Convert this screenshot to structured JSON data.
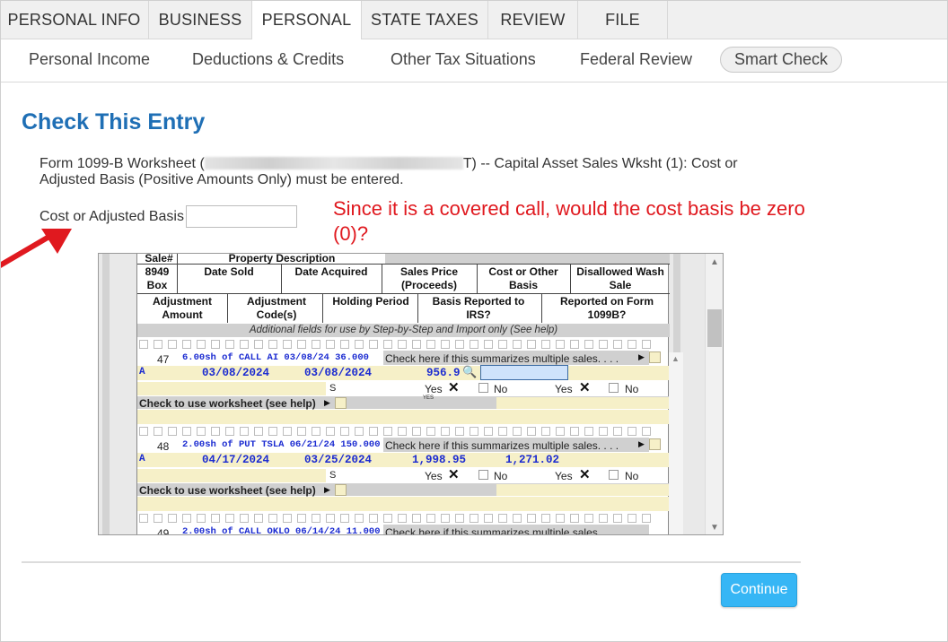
{
  "top_tabs": [
    {
      "label": "PERSONAL INFO"
    },
    {
      "label": "BUSINESS"
    },
    {
      "label": "PERSONAL"
    },
    {
      "label": "STATE TAXES"
    },
    {
      "label": "REVIEW"
    },
    {
      "label": "FILE"
    }
  ],
  "sub_nav": [
    {
      "label": "Personal Income"
    },
    {
      "label": "Deductions & Credits"
    },
    {
      "label": "Other Tax Situations"
    },
    {
      "label": "Federal Review"
    },
    {
      "label": "Smart Check"
    }
  ],
  "page_title": "Check This Entry",
  "description": {
    "prefix": "Form 1099-B Worksheet (",
    "suffix": "T) -- Capital Asset Sales Wksht (1): Cost or Adjusted Basis (Positive Amounts Only) must be entered."
  },
  "field": {
    "label": "Cost or Adjusted Basis",
    "value": ""
  },
  "annotation": "Since it is a covered call, would the cost basis be zero (0)?",
  "worksheet": {
    "headers": {
      "sale_no": "Sale#",
      "property_desc": "Property Description",
      "box_8949": "8949 Box",
      "date_sold": "Date Sold",
      "date_acquired": "Date Acquired",
      "sales_price": "Sales Price (Proceeds)",
      "cost_basis": "Cost or Other Basis",
      "wash_sale": "Disallowed Wash Sale",
      "adj_amount": "Adjustment Amount",
      "adj_codes": "Adjustment Code(s)",
      "holding": "Holding Period",
      "basis_reported": "Basis Reported to IRS?",
      "reported_1099b": "Reported on Form 1099B?"
    },
    "band_text": "Additional fields for use by Step-by-Step and Import only (See help)",
    "summarize_text": "Check here if this summarizes multiple sales. . . .",
    "worksheet_check": "Check to use worksheet (see help)",
    "yes_label": "Yes",
    "no_label": "No",
    "yes_small": "YES",
    "rows": [
      {
        "num": "47",
        "desc": "6.00sh of CALL AI 03/08/24 36.000",
        "box": "A",
        "date_sold": "03/08/2024",
        "date_acquired": "03/08/2024",
        "proceeds": "956.9",
        "cost": "",
        "holding": "S"
      },
      {
        "num": "48",
        "desc": "2.00sh of PUT TSLA 06/21/24 150.000",
        "box": "A",
        "date_sold": "04/17/2024",
        "date_acquired": "03/25/2024",
        "proceeds": "1,998.95",
        "cost": "1,271.02",
        "holding": "S"
      },
      {
        "num": "49",
        "desc": "2.00sh of CALL OKLO 06/14/24 11.000"
      }
    ]
  },
  "continue_label": "Continue",
  "colors": {
    "title_blue": "#1f6fb5",
    "annotation_red": "#e0191f",
    "button_blue": "#36b6f5"
  }
}
